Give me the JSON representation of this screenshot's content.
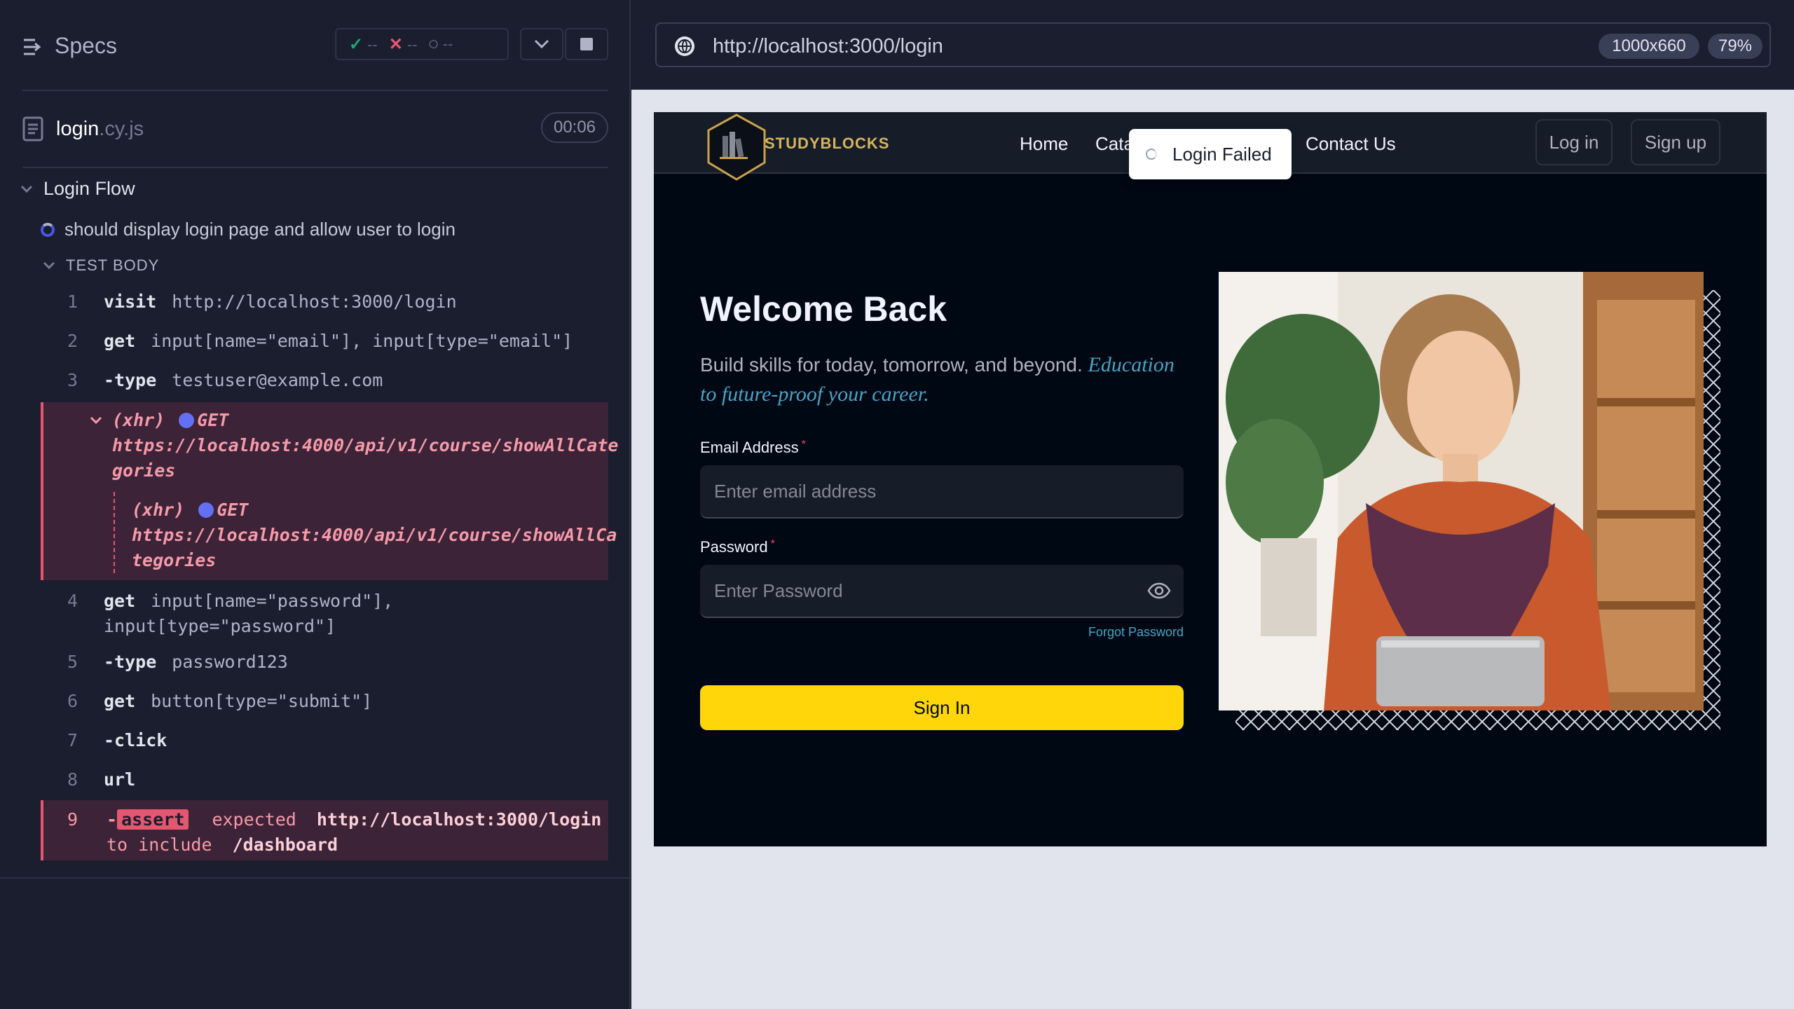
{
  "runner": {
    "title": "Specs",
    "stats": {
      "passed": "--",
      "failed": "--",
      "pending": "--"
    },
    "file": {
      "name": "login",
      "ext": ".cy.js",
      "duration": "00:06"
    },
    "suite": "Login Flow",
    "test": "should display login page and allow user to login",
    "section": "TEST BODY",
    "commands": [
      {
        "num": "1",
        "name": "visit",
        "msg": "http://localhost:3000/login"
      },
      {
        "num": "2",
        "name": "get",
        "msg": "input[name=\"email\"], input[type=\"email\"]"
      },
      {
        "num": "3",
        "name": "-type",
        "msg": "testuser@example.com"
      },
      {
        "num": "4",
        "name": "get",
        "msg": "input[name=\"password\"],",
        "msg2": "input[type=\"password\"]"
      },
      {
        "num": "5",
        "name": "-type",
        "msg": "password123"
      },
      {
        "num": "6",
        "name": "get",
        "msg": "button[type=\"submit\"]"
      },
      {
        "num": "7",
        "name": "-click",
        "msg": ""
      },
      {
        "num": "8",
        "name": "url",
        "msg": ""
      },
      {
        "num": "9",
        "name": "-",
        "badge": "assert",
        "expected": "expected",
        "url": "http://localhost:3000/login",
        "to_include": "to include",
        "target": "/dashboard"
      }
    ],
    "xhr": {
      "tag": "(xhr)",
      "method": "GET",
      "line1a": "https://localhost:4000/api/v1/course/showAllCate",
      "line1b": "gories",
      "line2a": "https://localhost:4000/api/v1/course/showAllCa",
      "line2b": "tegories"
    }
  },
  "browser": {
    "url": "http://localhost:3000/login",
    "viewport": "1000x660",
    "zoom": "79%"
  },
  "app": {
    "brand": "STUDYBLOCKS",
    "nav": [
      "Home",
      "Cata",
      "Contact Us"
    ],
    "toast": "Login Failed",
    "login_btn": "Log in",
    "signup_btn": "Sign up",
    "heading": "Welcome Back",
    "tagline": "Build skills for today, tomorrow, and beyond.",
    "tagline_highlight": "Education to future-proof your career.",
    "email_label": "Email Address",
    "email_placeholder": "Enter email address",
    "password_label": "Password",
    "password_placeholder": "Enter Password",
    "forgot": "Forgot Password",
    "signin": "Sign In",
    "required_mark": "*"
  },
  "colors": {
    "accent_yellow": "#ffd60a",
    "error_red": "#e45770",
    "pass_green": "#1fa971",
    "link_blue": "#47a5c5"
  }
}
